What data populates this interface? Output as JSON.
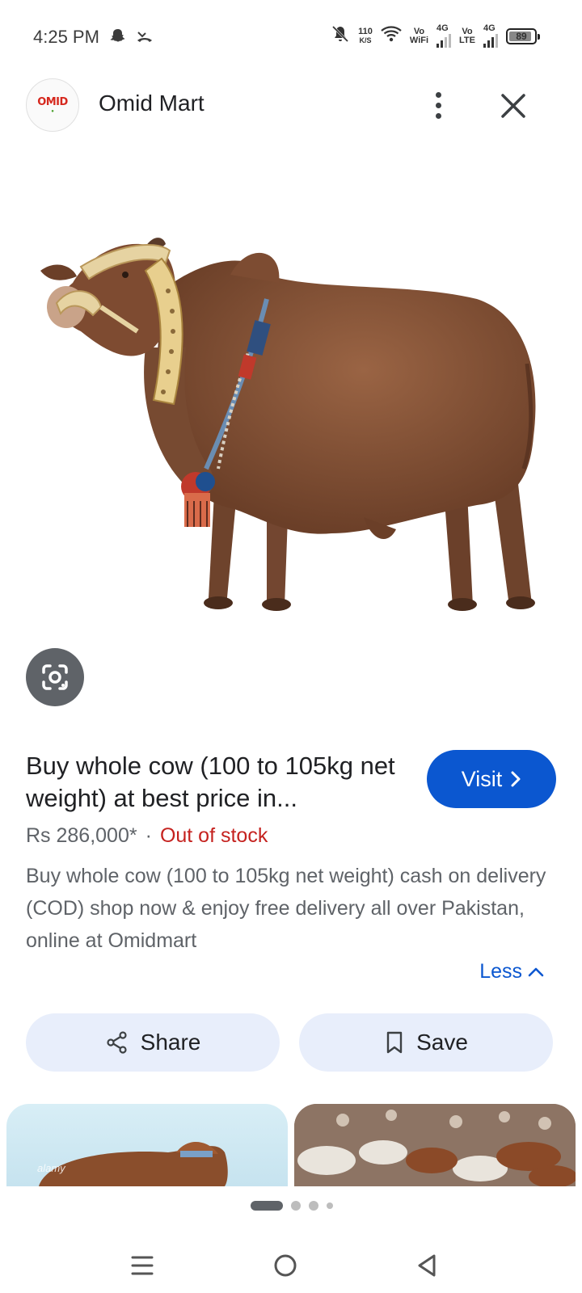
{
  "status_bar": {
    "time": "4:25 PM",
    "icons": [
      "snapchat-icon",
      "missed-call-icon",
      "mute-icon",
      "wifi-icon",
      "signal-icon"
    ],
    "speed_value": "110",
    "speed_unit": "K/S",
    "sim1_top": "Vo",
    "sim1_bottom": "WiFi",
    "sim1_network": "4G",
    "sim2_top": "Vo",
    "sim2_bottom": "LTE",
    "sim2_network": "4G",
    "battery": "89",
    "battery_level": 0.89
  },
  "header": {
    "site_name": "Omid Mart",
    "logo_text": "OMID",
    "more_icon": "more-vert-icon",
    "close_icon": "close-icon"
  },
  "product": {
    "title": "Buy whole cow (100 to 105kg net weight) at best price in...",
    "visit_label": "Visit",
    "price": "Rs 286,000*",
    "separator": "·",
    "stock_status": "Out of stock",
    "description": "Buy whole cow (100 to 105kg net weight) cash on delivery (COD) shop now & enjoy free delivery all over Pakistan, online at Omidmart",
    "less_label": "Less"
  },
  "actions": {
    "share_label": "Share",
    "save_label": "Save"
  },
  "thumbnails": {
    "watermark": "alamy"
  },
  "pager": {
    "pages": 4,
    "current": 1
  },
  "colors": {
    "accent": "#0b57d0",
    "out_of_stock": "#c5221f",
    "action_bg": "#e8eefb",
    "cow_body": "#7a4a30"
  }
}
